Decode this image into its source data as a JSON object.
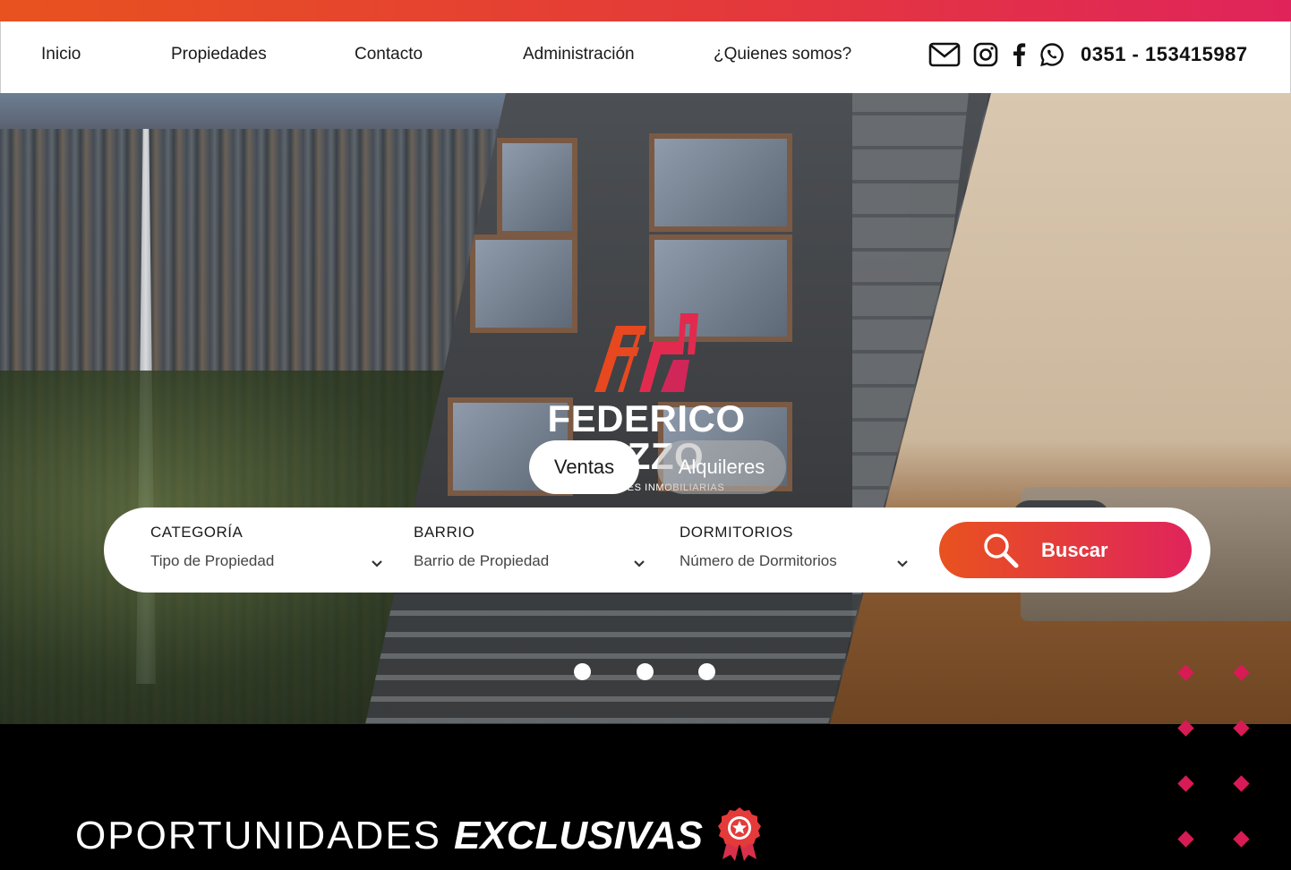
{
  "nav": {
    "items": [
      {
        "label": "Inicio"
      },
      {
        "label": "Propiedades"
      },
      {
        "label": "Contacto"
      },
      {
        "label": "Administración"
      },
      {
        "label": "¿Quienes somos?"
      }
    ],
    "phone": "0351 - 153415987",
    "icons": [
      "mail-icon",
      "instagram-icon",
      "facebook-icon",
      "whatsapp-icon"
    ]
  },
  "brand": {
    "name_line1": "FEDERICO",
    "name_line2": "RIZZO",
    "tagline": "INVERSIONES INMOBILIARIAS",
    "accent_color": "#e8521f",
    "accent_color_2": "#e0245b"
  },
  "hero": {
    "tabs": [
      {
        "label": "Ventas",
        "active": true
      },
      {
        "label": "Alquileres",
        "active": false
      }
    ],
    "slides_count": 3
  },
  "search": {
    "fields": [
      {
        "label": "CATEGORÍA",
        "value": "Tipo de Propiedad"
      },
      {
        "label": "BARRIO",
        "value": "Barrio de Propiedad"
      },
      {
        "label": "DORMITORIOS",
        "value": "Número de Dormitorios"
      }
    ],
    "button_label": "Buscar"
  },
  "section": {
    "title_light": "OPORTUNIDADES",
    "title_bold": "EXCLUSIVAS",
    "badge_icon": "award-ribbon-icon"
  }
}
